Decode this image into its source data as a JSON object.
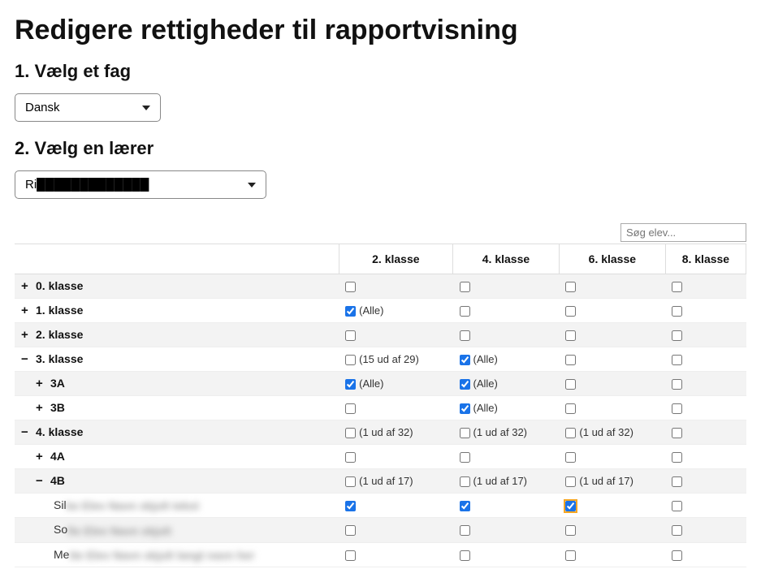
{
  "page_title": "Redigere rettigheder til rapportvisning",
  "step1_heading": "1. Vælg et fag",
  "step2_heading": "2. Vælg en lærer",
  "subject_select": {
    "value": "Dansk"
  },
  "teacher_select": {
    "visible_prefix": "Ri",
    "redacted_rest": "kkeNavn Lærer (skjult)"
  },
  "search": {
    "placeholder": "Søg elev..."
  },
  "columns": [
    "2. klasse",
    "4. klasse",
    "6. klasse",
    "8. klasse"
  ],
  "rows": [
    {
      "label": "0. klasse",
      "expand": "plus",
      "indent": 0,
      "cells": [
        {
          "checked": false,
          "text": ""
        },
        {
          "checked": false,
          "text": ""
        },
        {
          "checked": false,
          "text": ""
        },
        {
          "checked": false,
          "text": ""
        }
      ]
    },
    {
      "label": "1. klasse",
      "expand": "plus",
      "indent": 0,
      "cells": [
        {
          "checked": true,
          "text": "(Alle)"
        },
        {
          "checked": false,
          "text": ""
        },
        {
          "checked": false,
          "text": ""
        },
        {
          "checked": false,
          "text": ""
        }
      ]
    },
    {
      "label": "2. klasse",
      "expand": "plus",
      "indent": 0,
      "cells": [
        {
          "checked": false,
          "text": ""
        },
        {
          "checked": false,
          "text": ""
        },
        {
          "checked": false,
          "text": ""
        },
        {
          "checked": false,
          "text": ""
        }
      ]
    },
    {
      "label": "3. klasse",
      "expand": "minus",
      "indent": 0,
      "cells": [
        {
          "checked": false,
          "text": "(15 ud af 29)"
        },
        {
          "checked": true,
          "text": "(Alle)"
        },
        {
          "checked": false,
          "text": ""
        },
        {
          "checked": false,
          "text": ""
        }
      ]
    },
    {
      "label": "3A",
      "expand": "plus",
      "indent": 1,
      "cells": [
        {
          "checked": true,
          "text": "(Alle)"
        },
        {
          "checked": true,
          "text": "(Alle)"
        },
        {
          "checked": false,
          "text": ""
        },
        {
          "checked": false,
          "text": ""
        }
      ]
    },
    {
      "label": "3B",
      "expand": "plus",
      "indent": 1,
      "cells": [
        {
          "checked": false,
          "text": ""
        },
        {
          "checked": true,
          "text": "(Alle)"
        },
        {
          "checked": false,
          "text": ""
        },
        {
          "checked": false,
          "text": ""
        }
      ]
    },
    {
      "label": "4. klasse",
      "expand": "minus",
      "indent": 0,
      "cells": [
        {
          "checked": false,
          "text": "(1 ud af 32)"
        },
        {
          "checked": false,
          "text": "(1 ud af 32)"
        },
        {
          "checked": false,
          "text": "(1 ud af 32)"
        },
        {
          "checked": false,
          "text": ""
        }
      ]
    },
    {
      "label": "4A",
      "expand": "plus",
      "indent": 1,
      "cells": [
        {
          "checked": false,
          "text": ""
        },
        {
          "checked": false,
          "text": ""
        },
        {
          "checked": false,
          "text": ""
        },
        {
          "checked": false,
          "text": ""
        }
      ]
    },
    {
      "label": "4B",
      "expand": "minus",
      "indent": 1,
      "cells": [
        {
          "checked": false,
          "text": "(1 ud af 17)"
        },
        {
          "checked": false,
          "text": "(1 ud af 17)"
        },
        {
          "checked": false,
          "text": "(1 ud af 17)"
        },
        {
          "checked": false,
          "text": ""
        }
      ]
    },
    {
      "label_prefix": "Sil",
      "label_redacted": "ke Elev Navn skjult tekst",
      "expand": "none",
      "indent": 2,
      "is_student": true,
      "cells": [
        {
          "checked": true,
          "text": ""
        },
        {
          "checked": true,
          "text": ""
        },
        {
          "checked": true,
          "text": "",
          "highlight": true
        },
        {
          "checked": false,
          "text": ""
        }
      ]
    },
    {
      "label_prefix": "So",
      "label_redacted": "fie Elev Navn skjult",
      "expand": "none",
      "indent": 2,
      "is_student": true,
      "cells": [
        {
          "checked": false,
          "text": ""
        },
        {
          "checked": false,
          "text": ""
        },
        {
          "checked": false,
          "text": ""
        },
        {
          "checked": false,
          "text": ""
        }
      ]
    },
    {
      "label_prefix": "Me",
      "label_redacted": "tte Elev Navn skjult langt navn her",
      "expand": "none",
      "indent": 2,
      "is_student": true,
      "cells": [
        {
          "checked": false,
          "text": ""
        },
        {
          "checked": false,
          "text": ""
        },
        {
          "checked": false,
          "text": ""
        },
        {
          "checked": false,
          "text": ""
        }
      ]
    }
  ]
}
